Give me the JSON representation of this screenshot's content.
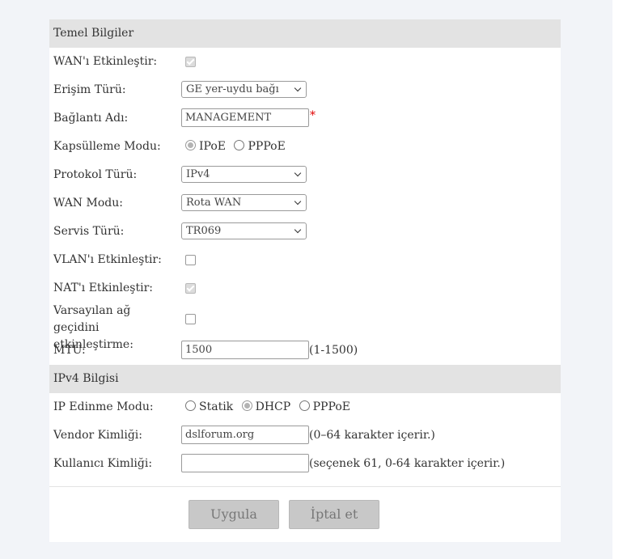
{
  "basic_section": {
    "title": "Temel Bilgiler"
  },
  "fields": {
    "wan_enable": {
      "label": "WAN'ı Etkinleştir:",
      "checked": true
    },
    "access_type": {
      "label": "Erişim Türü:",
      "value": "GE yer-uydu bağı"
    },
    "connection_name": {
      "label": "Bağlantı Adı:",
      "value": "MANAGEMENT",
      "required_mark": "*"
    },
    "encapsulation": {
      "label": "Kapsülleme Modu:",
      "options": [
        "IPoE",
        "PPPoE"
      ],
      "selected": "IPoE"
    },
    "protocol_type": {
      "label": "Protokol Türü:",
      "value": "IPv4"
    },
    "wan_mode": {
      "label": "WAN Modu:",
      "value": "Rota WAN"
    },
    "service_type": {
      "label": "Servis Türü:",
      "value": "TR069"
    },
    "vlan_enable": {
      "label": "VLAN'ı Etkinleştir:",
      "checked": false
    },
    "nat_enable": {
      "label": "NAT'ı Etkinleştir:",
      "checked": true
    },
    "default_gateway": {
      "label": "Varsayılan ağ geçidini etkinleştirme:",
      "checked": false
    },
    "mtu": {
      "label": "MTU:",
      "value": "1500",
      "hint": "(1-1500)"
    }
  },
  "ipv4_section": {
    "title": "IPv4 Bilgisi"
  },
  "ipv4_fields": {
    "ip_mode": {
      "label": "IP Edinme Modu:",
      "options": [
        "Statik",
        "DHCP",
        "PPPoE"
      ],
      "selected": "DHCP"
    },
    "vendor_id": {
      "label": "Vendor Kimliği:",
      "value": "dslforum.org",
      "hint": "(0–64 karakter içerir.)"
    },
    "user_id": {
      "label": "Kullanıcı Kimliği:",
      "value": "",
      "hint": "(seçenek 61, 0-64 karakter içerir.)"
    }
  },
  "buttons": {
    "apply": "Uygula",
    "cancel": "İptal et"
  },
  "colors": {
    "section_header_bg": "#e3e3e3",
    "button_bg": "#c8c8c8",
    "required": "#e00000"
  }
}
